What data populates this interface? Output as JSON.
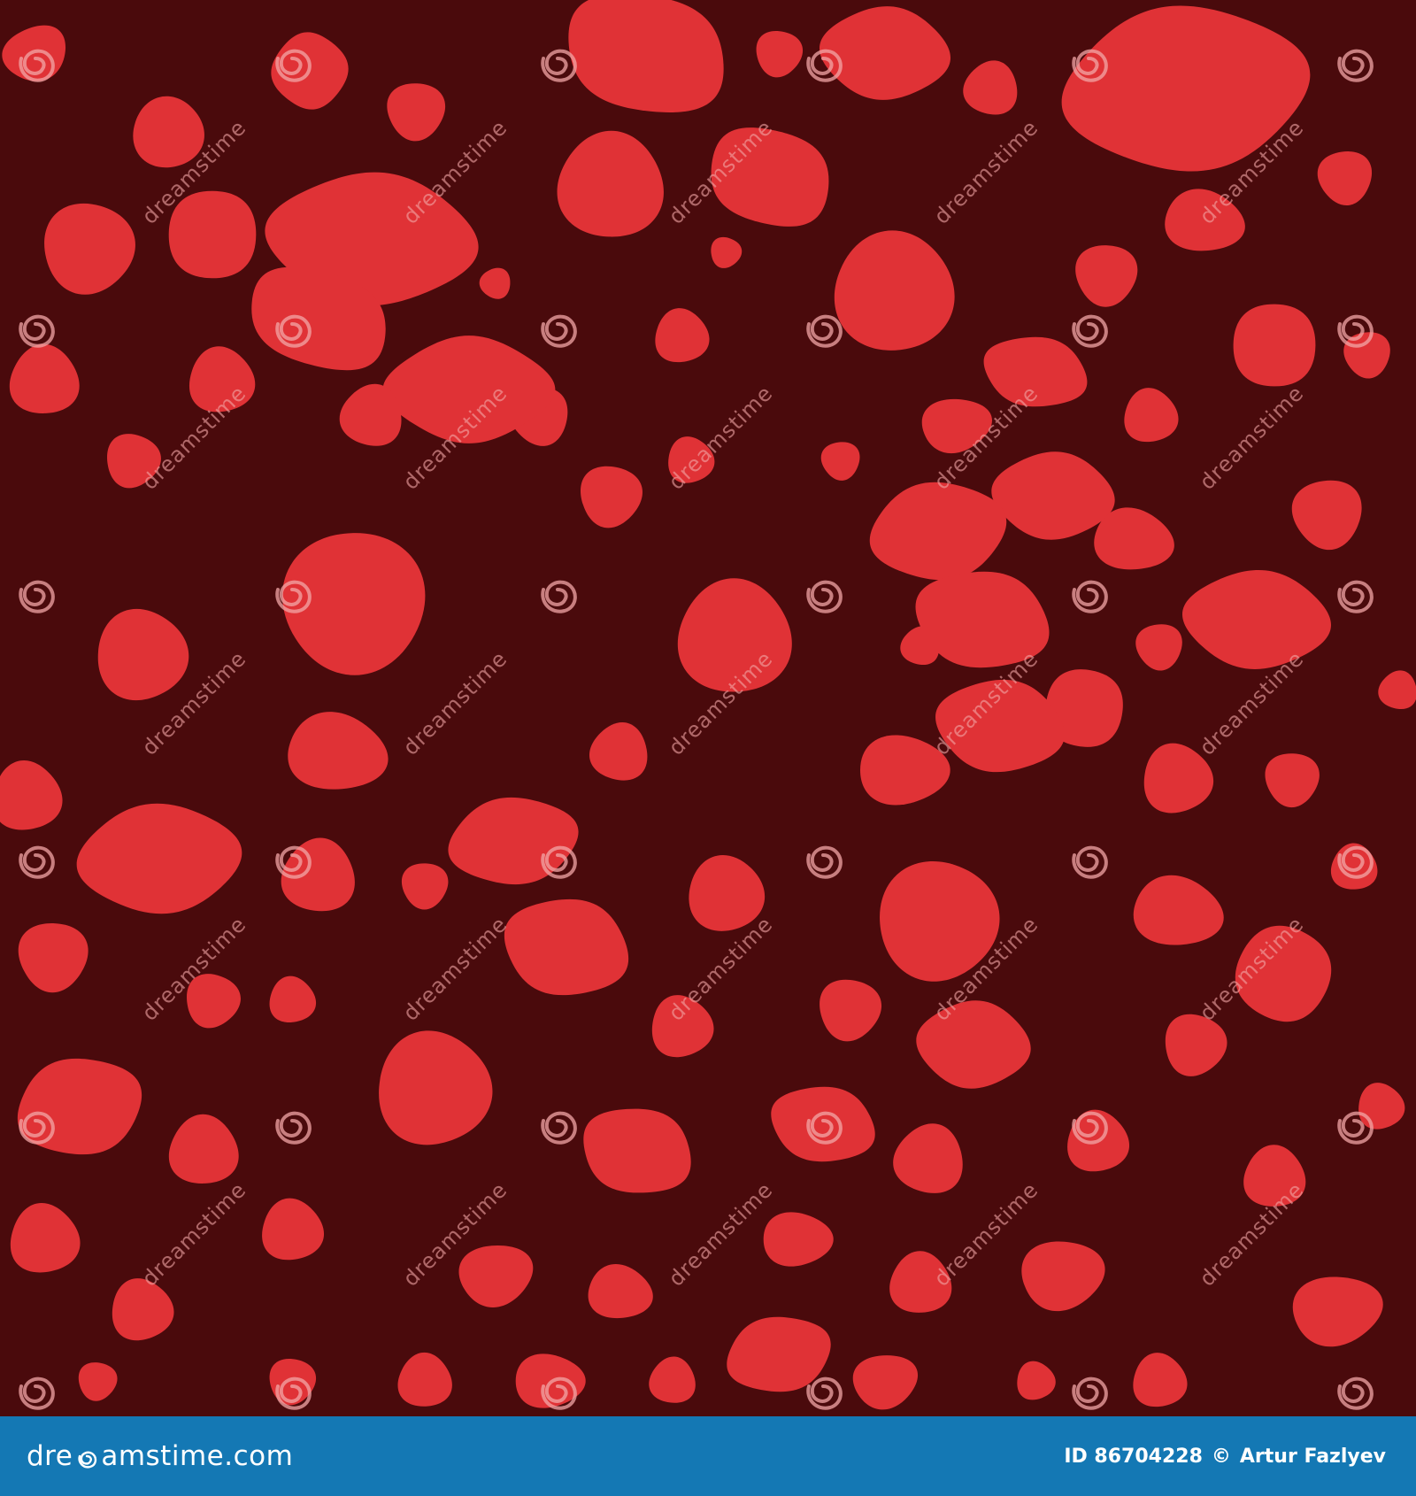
{
  "colors": {
    "background": "#4a0a0c",
    "pebble": "#e03236",
    "footer": "#1478b4",
    "watermark": "#f3a7a7"
  },
  "watermark": {
    "text": "dreamstime",
    "icon": "spiral-icon"
  },
  "footer": {
    "brand_prefix": "dre",
    "brand_suffix": "amstime.com",
    "brand_icon": "spiral-icon",
    "id_text": "ID 86704228",
    "copyright_text": "©",
    "author_text": "Artur Fazlyev"
  }
}
